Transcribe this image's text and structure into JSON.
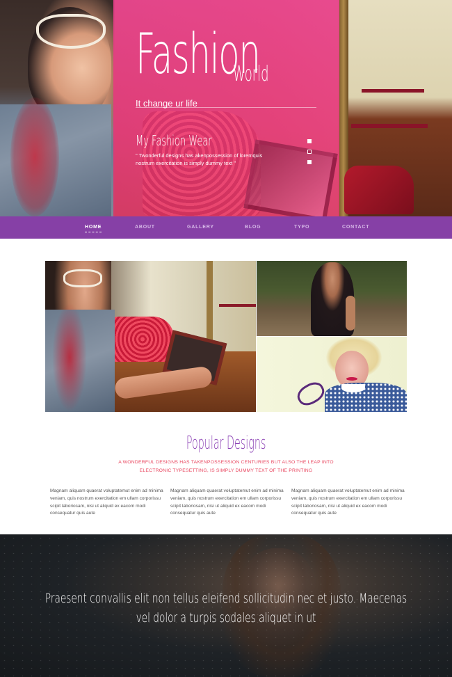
{
  "hero": {
    "logo_main": "Fashion",
    "logo_sub": "World",
    "tagline": "It change ur life",
    "slide_title": "My Fashion Wear",
    "slide_text": "\" Twonderful designs has akenpossession of loremquis nostrum exercitation is simply dummy text \"",
    "slide_dots": 3,
    "active_dot": 2
  },
  "nav": {
    "items": [
      {
        "label": "HOME",
        "active": true
      },
      {
        "label": "ABOUT",
        "active": false
      },
      {
        "label": "GALLERY",
        "active": false
      },
      {
        "label": "BLOG",
        "active": false
      },
      {
        "label": "TYPO",
        "active": false
      },
      {
        "label": "CONTACT",
        "active": false
      }
    ]
  },
  "popular": {
    "title": "Popular Designs",
    "subtitle": "A WONDERFUL DESIGNS HAS TAKENPOSSESSION CENTURIES BUT ALSO THE LEAP INTO ELECTRONIC TYPESETTING, IS SIMPLY DUMMY TEXT OF THE PRINTING",
    "columns": [
      "Magnam aliquam quaerat voluptatemut enim ad minima veniam, quis nostrum exercitation em ullam corporissu scipit laboriosam, nisi ut aliquid ex eacom modi consequatur quis aute",
      "Magnam aliquam quaerat voluptatemut enim ad minima veniam, quis nostrum exercitation em ullam corporissu scipit laboriosam, nisi ut aliquid ex eacom modi consequatur quis aute",
      "Magnam aliquam quaerat voluptatemut enim ad minima veniam, quis nostrum exercitation em ullam corporissu scipit laboriosam, nisi ut aliquid ex eacom modi consequatur quis aute"
    ]
  },
  "quote": {
    "text": "Praesent convallis elit non tellus eleifend sollicitudin nec et justo. Maecenas vel dolor a turpis sodales aliquet in ut"
  },
  "colors": {
    "accent_pink": "#e9408c",
    "nav_purple": "#8640a6",
    "title_purple": "#8a3fb4",
    "subtitle_red": "#e8455e"
  }
}
